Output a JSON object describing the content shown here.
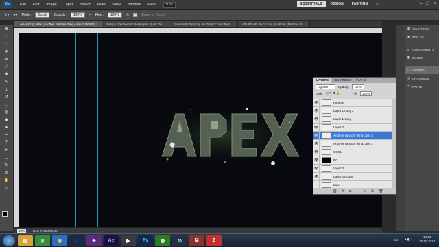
{
  "menubar": {
    "logo": "Ps",
    "items": [
      "File",
      "Edit",
      "Image",
      "Layer",
      "Select",
      "Filter",
      "View",
      "Window",
      "Help"
    ],
    "zoom": "50%",
    "workspaces": [
      "ESSENTIALS",
      "DESIGN",
      "PAINTING"
    ],
    "active_workspace": "ESSENTIALS",
    "more": "»"
  },
  "optbar": {
    "mode_label": "Mode:",
    "mode_value": "Brush",
    "opacity_label": "Opacity:",
    "opacity_value": "100%",
    "flow_label": "Flow:",
    "flow_value": "100%",
    "erase_label": "Erase to History"
  },
  "tabs": [
    {
      "label": "Lenv.psd @ 50% (Another random thing copy 3, RGB/8) *",
      "active": true
    },
    {
      "label": "Setups, Renders & Stocks.psd @ 66.7%...",
      "active": false
    },
    {
      "label": "Drew Psd v2.psd @ 66.7% (CC, Nut By N...",
      "active": false
    },
    {
      "label": "AZURE-3D PACK.psd @ 66.7% (Particle v1...",
      "active": false
    }
  ],
  "statusbar": {
    "zoom": "50%",
    "doc": "Doc: 7,24M/56,3M"
  },
  "layers_panel": {
    "tabs": [
      "LAYERS",
      "CHANNELS",
      "PATHS"
    ],
    "active_tab": "LAYERS",
    "blend_mode": "Lighten",
    "opacity_label": "Opacity:",
    "opacity_value": "100%",
    "lock_label": "Lock:",
    "fill_label": "Fill:",
    "fill_value": "100%",
    "layers": [
      {
        "name": "Particle",
        "visible": true,
        "selected": false,
        "thumb": "chain"
      },
      {
        "name": "Layer 1 copy 2",
        "visible": true,
        "selected": false,
        "thumb": "chain"
      },
      {
        "name": "Layer 1 copy",
        "visible": true,
        "selected": false,
        "thumb": "chain"
      },
      {
        "name": "Layer 2",
        "visible": true,
        "selected": false,
        "thumb": "chain"
      },
      {
        "name": "Another random thing copy 3",
        "visible": true,
        "selected": true,
        "thumb": "chain"
      },
      {
        "name": "Another random thing copy 2",
        "visible": true,
        "selected": false,
        "thumb": "chain"
      },
      {
        "name": "COOL",
        "visible": true,
        "selected": false,
        "thumb": "chain"
      },
      {
        "name": "BG",
        "visible": true,
        "selected": false,
        "thumb": "dark"
      },
      {
        "name": "Layer 3",
        "visible": true,
        "selected": false,
        "thumb": "chain"
      },
      {
        "name": "Layer 25 copy",
        "visible": true,
        "selected": false,
        "thumb": "chain"
      },
      {
        "name": "Later",
        "visible": false,
        "selected": false,
        "thumb": "chain"
      }
    ]
  },
  "dock": {
    "items": [
      {
        "label": "SWATCHES",
        "icon": "swatches-icon",
        "glyph": "▦"
      },
      {
        "label": "STYLES",
        "icon": "styles-icon",
        "glyph": "◈"
      },
      {
        "label": "ADJUSTMENTS",
        "icon": "adjustments-icon",
        "glyph": "◐"
      },
      {
        "label": "MASKS",
        "icon": "masks-icon",
        "glyph": "◧"
      },
      {
        "label": "LAYERS",
        "icon": "layers-icon",
        "glyph": "◫"
      },
      {
        "label": "CHANNELS",
        "icon": "channels-icon",
        "glyph": "◎"
      },
      {
        "label": "PATHS",
        "icon": "paths-icon",
        "glyph": "✎"
      }
    ],
    "active": "LAYERS"
  },
  "taskbar": {
    "icons": [
      {
        "name": "explorer-icon",
        "glyph": "▤",
        "bg": "#d8a23a",
        "color": "#fff"
      },
      {
        "name": "utorrent-icon",
        "glyph": "µ",
        "bg": "#3a8c3a",
        "color": "#fff"
      },
      {
        "name": "chrome-icon",
        "glyph": "◉",
        "bg": "#2d6ebd",
        "color": "#f4d03f"
      },
      {
        "name": "cinema4d-icon",
        "glyph": "◌",
        "bg": "#1b2a44",
        "color": "#7fb3ff"
      },
      {
        "name": "feather-icon",
        "glyph": "✒",
        "bg": "#5b2a7a",
        "color": "#fff"
      },
      {
        "name": "after-effects-icon",
        "glyph": "Ae",
        "bg": "#1a1140",
        "color": "#b39cff"
      },
      {
        "name": "media-icon",
        "glyph": "▶",
        "bg": "#3a3a3a",
        "color": "#fff"
      },
      {
        "name": "photoshop-icon",
        "glyph": "Ps",
        "bg": "#0d2a4c",
        "color": "#6fc3ff"
      },
      {
        "name": "globe-icon",
        "glyph": "◍",
        "bg": "#2a7a2a",
        "color": "#fff"
      },
      {
        "name": "steam-icon",
        "glyph": "⊙",
        "bg": "#223040",
        "color": "#fff"
      },
      {
        "name": "dual-icon",
        "glyph": "⧉",
        "bg": "#8a3030",
        "color": "#fff"
      },
      {
        "name": "filezilla-icon",
        "glyph": "Z",
        "bg": "#c23030",
        "color": "#fff"
      }
    ],
    "lang": "NO",
    "time": "14:33",
    "date": "20.05.2013"
  },
  "colors": {
    "guide": "#3fb3d6",
    "selected_layer": "#3a79d6",
    "canvas_bg": "#07090e"
  }
}
